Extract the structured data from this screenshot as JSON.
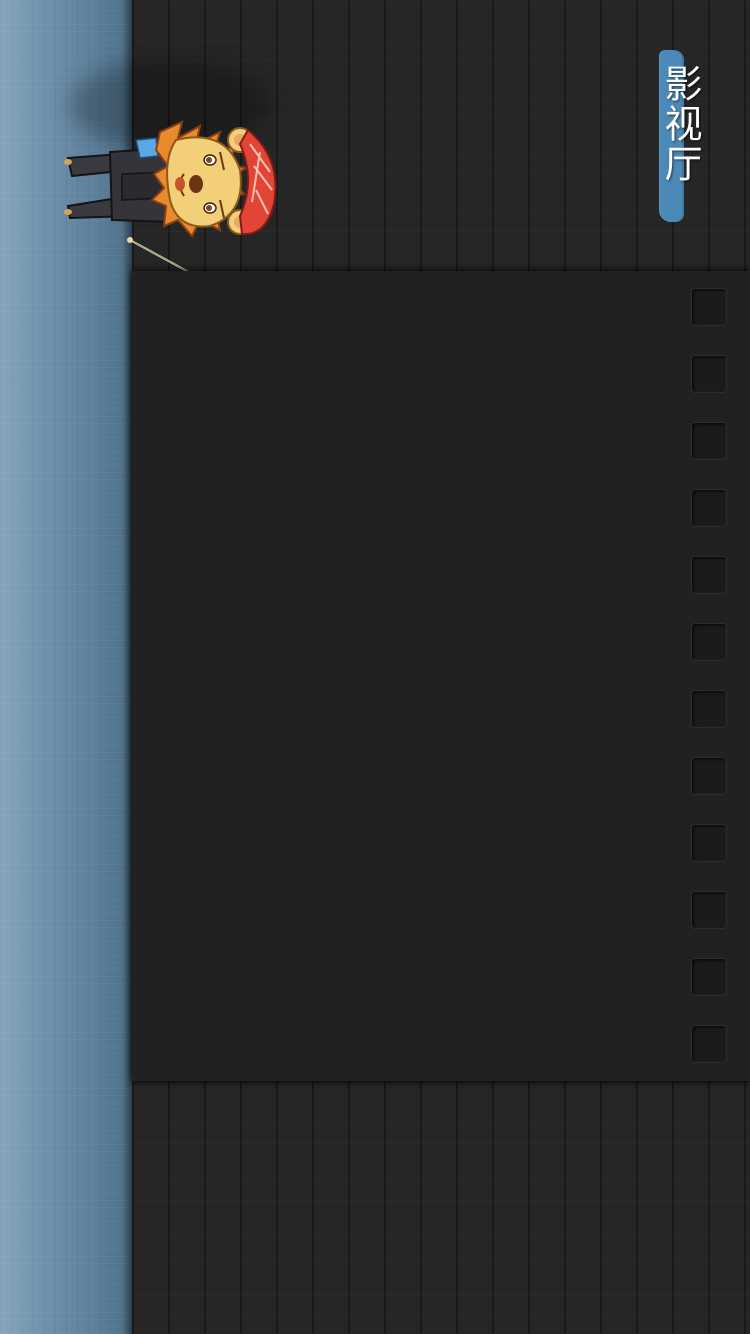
{
  "header": {
    "title": "影视厅"
  },
  "film_panel": {
    "sprocket_count": 12
  },
  "mascot": {
    "icon": "lion-conductor-mascot"
  },
  "colors": {
    "accent": "#4b8ab6",
    "panel": "#212121",
    "wood": "#262626",
    "side_strip": "#6f91ab"
  }
}
